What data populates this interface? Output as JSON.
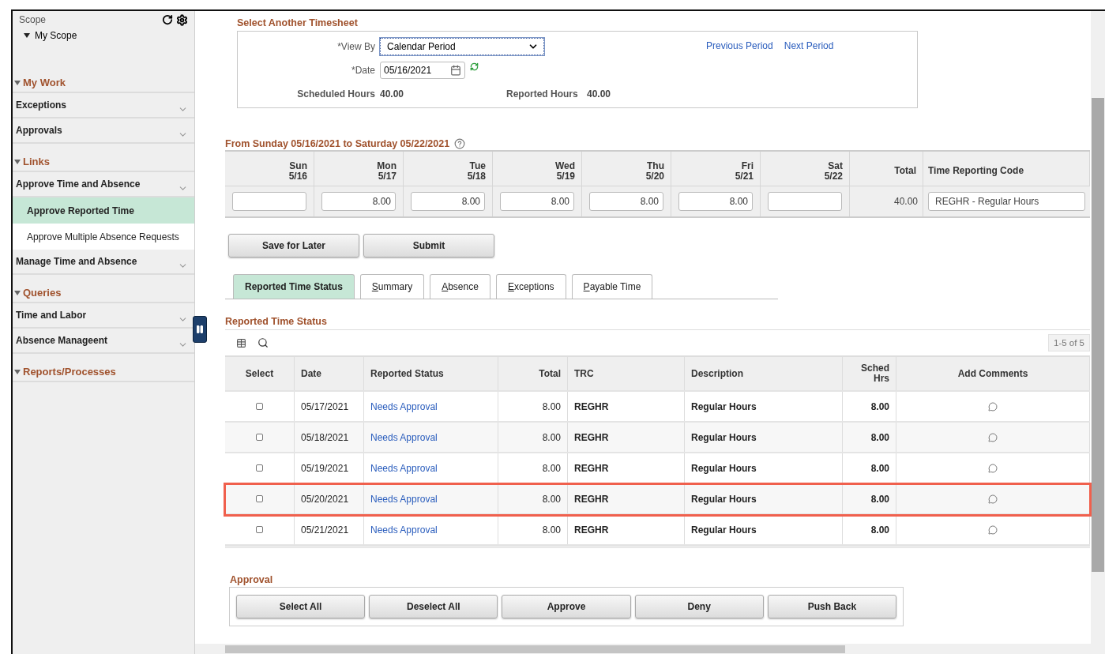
{
  "sidebar": {
    "scope_label": "Scope",
    "scope_item": "My Scope",
    "sections": [
      {
        "title": "My Work",
        "expanded": true,
        "items": [
          {
            "kind": "group",
            "label": "Exceptions",
            "selected": false
          },
          {
            "kind": "group",
            "label": "Approvals",
            "selected": false
          }
        ]
      },
      {
        "title": "Links",
        "expanded": true,
        "items": [
          {
            "kind": "group",
            "label": "Approve Time and Absence",
            "selected": false
          },
          {
            "kind": "link",
            "label": "Approve Reported Time",
            "selected": true
          },
          {
            "kind": "link",
            "label": "Approve Multiple Absence Requests",
            "selected": false
          },
          {
            "kind": "group",
            "label": "Manage Time and Absence",
            "selected": false
          }
        ]
      },
      {
        "title": "Queries",
        "expanded": true,
        "items": [
          {
            "kind": "group",
            "label": "Time and Labor",
            "selected": false
          },
          {
            "kind": "group",
            "label": "Absence Manageent",
            "selected": false
          }
        ]
      },
      {
        "title": "Reports/Processes",
        "expanded": true
      }
    ]
  },
  "timesheet": {
    "title": "Select Another Timesheet",
    "view_by_label": "*View By",
    "view_by": "Calendar Period",
    "date_label": "*Date",
    "date": "05/16/2021",
    "scheduled_label": "Scheduled Hours",
    "scheduled": "40.00",
    "reported_label": "Reported Hours",
    "reported": "40.00",
    "links": [
      "Previous Period",
      "Next Period"
    ]
  },
  "week": {
    "title": "From Sunday 05/16/2021 to Saturday 05/22/2021",
    "days": [
      {
        "day": "Sun",
        "date": "5/16"
      },
      {
        "day": "Mon",
        "date": "5/17",
        "value": "8.00"
      },
      {
        "day": "Tue",
        "date": "5/18",
        "value": "8.00"
      },
      {
        "day": "Wed",
        "date": "5/19",
        "value": "8.00"
      },
      {
        "day": "Thu",
        "date": "5/20",
        "value": "8.00"
      },
      {
        "day": "Fri",
        "date": "5/21",
        "value": "8.00"
      },
      {
        "day": "Sat",
        "date": "5/22"
      }
    ],
    "total_label": "Total",
    "total": "40.00",
    "trc_label": "Time Reporting Code",
    "trc": "REGHR - Regular Hours"
  },
  "actions": [
    "Save for Later",
    "Submit"
  ],
  "tabs": [
    {
      "label": "Reported Time Status",
      "selected": true,
      "access_key": false
    },
    {
      "label": "Summary",
      "selected": false,
      "access_key": true
    },
    {
      "label": "Absence",
      "selected": false,
      "access_key": true
    },
    {
      "label": "Exceptions",
      "selected": false,
      "access_key": true
    },
    {
      "label": "Payable Time",
      "selected": false,
      "access_key": true
    }
  ],
  "status_grid": {
    "title": "Reported Time Status",
    "count": "1-5 of 5",
    "columns": [
      "Select",
      "Date",
      "Reported Status",
      "Total",
      "TRC",
      "Description",
      "Sched Hrs",
      "Add Comments"
    ],
    "rows": [
      {
        "checked": false,
        "date": "05/17/2021",
        "status": "Needs Approval",
        "total": "8.00",
        "trc": "REGHR",
        "description": "Regular Hours",
        "sched": "8.00",
        "highlighted": false
      },
      {
        "checked": false,
        "date": "05/18/2021",
        "status": "Needs Approval",
        "total": "8.00",
        "trc": "REGHR",
        "description": "Regular Hours",
        "sched": "8.00",
        "highlighted": false
      },
      {
        "checked": false,
        "date": "05/19/2021",
        "status": "Needs Approval",
        "total": "8.00",
        "trc": "REGHR",
        "description": "Regular Hours",
        "sched": "8.00",
        "highlighted": false
      },
      {
        "checked": false,
        "date": "05/20/2021",
        "status": "Needs Approval",
        "total": "8.00",
        "trc": "REGHR",
        "description": "Regular Hours",
        "sched": "8.00",
        "highlighted": true
      },
      {
        "checked": false,
        "date": "05/21/2021",
        "status": "Needs Approval",
        "total": "8.00",
        "trc": "REGHR",
        "description": "Regular Hours",
        "sched": "8.00",
        "highlighted": false
      }
    ]
  },
  "approval": {
    "title": "Approval",
    "buttons": [
      "Select All",
      "Deselect All",
      "Approve",
      "Deny",
      "Push Back"
    ]
  }
}
